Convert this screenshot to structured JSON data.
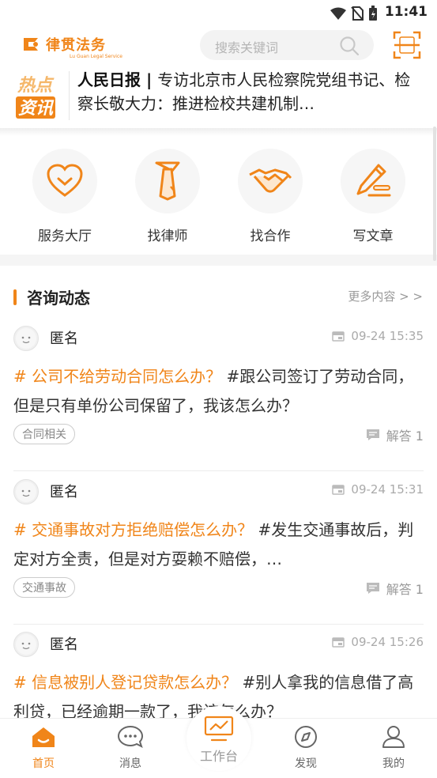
{
  "status": {
    "time": "11:41"
  },
  "header": {
    "logo_name": "律贯法务",
    "logo_sub": "Lu Guan Legal Service",
    "search_placeholder": "搜索关键词"
  },
  "news": {
    "source": "人民日报 | ",
    "headline": "专访北京市人民检察院党组书记、检察长敬大力：推进检校共建机制…"
  },
  "quick_links": [
    {
      "label": "服务大厅",
      "icon": "heart-icon"
    },
    {
      "label": "找律师",
      "icon": "tie-icon"
    },
    {
      "label": "找合作",
      "icon": "handshake-icon"
    },
    {
      "label": "写文章",
      "icon": "pencil-icon"
    }
  ],
  "section": {
    "title": "咨询动态",
    "more": "更多内容 > >"
  },
  "posts": [
    {
      "user": "匿名",
      "time": "09-24 15:35",
      "topic": "# 公司不给劳动合同怎么办？",
      "body": "#跟公司签订了劳动合同，但是只有单份公司保留了，我该怎么办？",
      "tag": "合同相关",
      "answers": "解答 1"
    },
    {
      "user": "匿名",
      "time": "09-24 15:31",
      "topic": "# 交通事故对方拒绝赔偿怎么办？",
      "body": "#发生交通事故后，判定对方全责，但是对方耍赖不赔偿，…",
      "tag": "交通事故",
      "answers": "解答 1"
    },
    {
      "user": "匿名",
      "time": "09-24 15:26",
      "topic": "# 信息被别人登记贷款怎么办？",
      "body": "#别人拿我的信息借了高利贷，已经逾期一款了，我该怎么办？",
      "tag": "",
      "answers": ""
    }
  ],
  "tabs": [
    {
      "label": "首页",
      "icon": "home-icon"
    },
    {
      "label": "消息",
      "icon": "message-icon"
    },
    {
      "label": "工作台",
      "icon": "monitor-icon"
    },
    {
      "label": "发现",
      "icon": "compass-icon"
    },
    {
      "label": "我的",
      "icon": "user-icon"
    }
  ],
  "colors": {
    "accent": "#f08519"
  }
}
